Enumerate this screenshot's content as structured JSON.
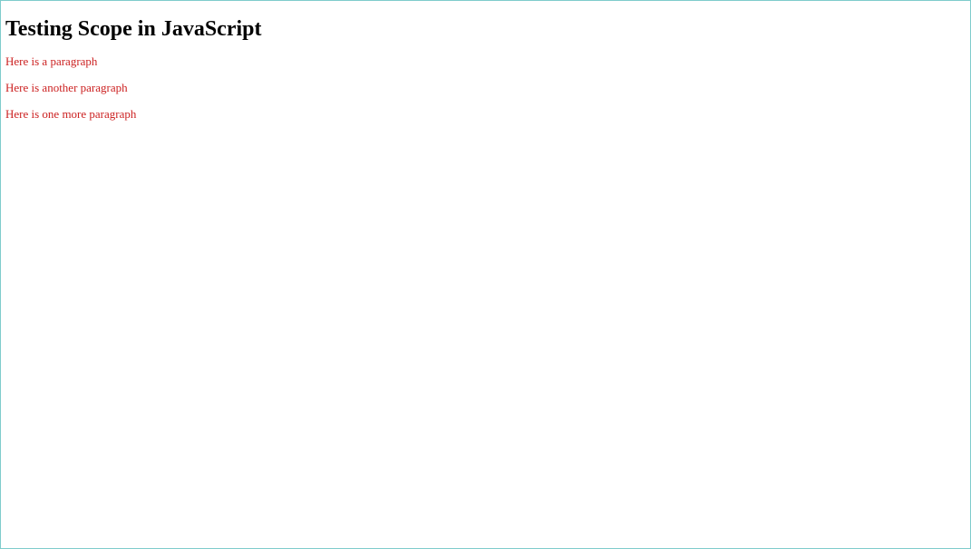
{
  "heading": "Testing Scope in JavaScript",
  "paragraphs": [
    "Here is a paragraph",
    "Here is another paragraph",
    "Here is one more paragraph"
  ]
}
